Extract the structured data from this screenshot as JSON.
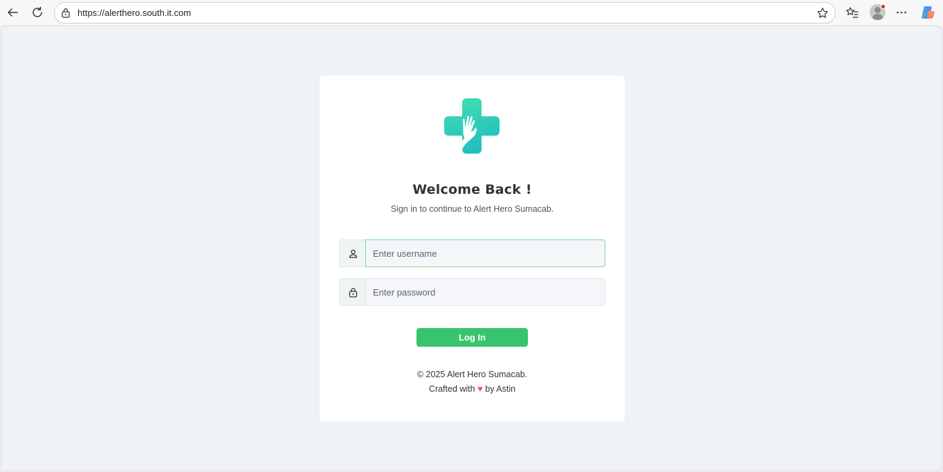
{
  "browser": {
    "url": "https://alerthero.south.it.com"
  },
  "login": {
    "title": "Welcome Back !",
    "subtitle": "Sign in to continue to Alert Hero Sumacab.",
    "username_placeholder": "Enter username",
    "password_placeholder": "Enter password",
    "login_label": "Log In",
    "copyright": "© 2025 Alert Hero Sumacab.",
    "crafted_prefix": "Crafted with",
    "crafted_suffix": "by Astin",
    "heart_glyph": "♥"
  },
  "colors": {
    "accent_green": "#38c46e",
    "logo_teal": "#3fd1b4",
    "heart": "#f05a4f",
    "page_bg": "#eff2f7"
  },
  "icons": [
    "back-arrow-icon",
    "reload-icon",
    "lock-icon",
    "star-icon",
    "favorites-icon",
    "more-icon",
    "copilot-icon",
    "user-icon",
    "padlock-icon",
    "heart-icon"
  ]
}
